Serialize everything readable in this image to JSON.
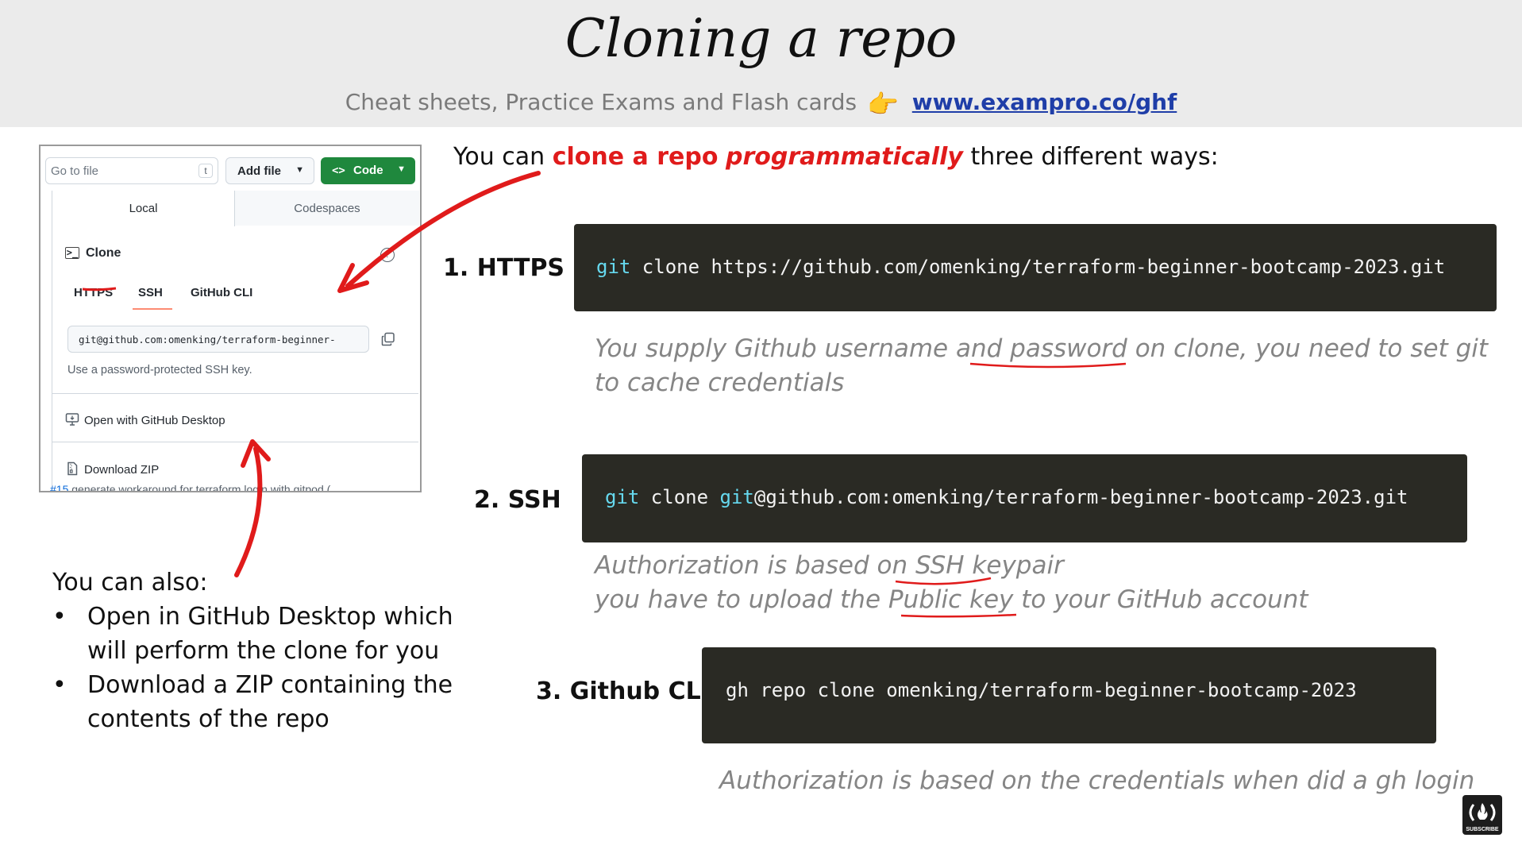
{
  "header": {
    "title": "Cloning a repo",
    "subtitle": "Cheat sheets, Practice Exams and Flash cards",
    "pointer_icon": "👉",
    "link": "www.exampro.co/ghf"
  },
  "github_panel": {
    "go_to_file_placeholder": "Go to file",
    "go_to_file_shortcut": "t",
    "add_file_label": "Add file",
    "code_label": "Code",
    "tabs": [
      "Local",
      "Codespaces"
    ],
    "clone_label": "Clone",
    "protocol_tabs": [
      "HTTPS",
      "SSH",
      "GitHub CLI"
    ],
    "selected_protocol": "SSH",
    "clone_url": "git@github.com:omenking/terraform-beginner-",
    "hint": "Use a password-protected SSH key.",
    "open_desktop_label": "Open with GitHub Desktop",
    "download_zip_label": "Download ZIP",
    "issue_number": "#15",
    "issue_text": "generate workaround for terraform login with gitpod ("
  },
  "intro": {
    "prefix": "You can ",
    "highlight": "clone a repo",
    "space": " ",
    "highlight_italic": "programmatically",
    "suffix": " three different ways:"
  },
  "methods": [
    {
      "label": "1. HTTPS",
      "cmd": "git",
      "command": " clone https://github.com/omenking/terraform-beginner-bootcamp-2023.git",
      "note_line1": "You supply Github username and password on clone, you need to set git",
      "note_line2": "to cache credentials"
    },
    {
      "label": "2. SSH",
      "cmd": "git",
      "command_mid": " clone ",
      "user": "git",
      "command_rest": "@github.com:omenking/terraform-beginner-bootcamp-2023.git",
      "note_line1": "Authorization is based on SSH keypair",
      "note_line2": "you have to upload the Public key to your GitHub account"
    },
    {
      "label": "3. Github CLI",
      "command": "gh repo clone omenking/terraform-beginner-bootcamp-2023",
      "note_line1": "Authorization is based on the credentials when did a gh login"
    }
  ],
  "also": {
    "heading": "You can also:",
    "bullet_glyph": "•",
    "item1_line1": "Open in GitHub Desktop which",
    "item1_line2": "will perform the clone for you",
    "item2_line1": "Download a ZIP containing the",
    "item2_line2": "contents of the repo"
  },
  "badge": {
    "label": "SUBSCRIBE"
  },
  "colors": {
    "accent_red": "#e01b1b",
    "code_bg": "#2a2a24",
    "code_keyword": "#66d9ef",
    "github_green": "#1f883d",
    "link_blue": "#1f3ea8"
  }
}
